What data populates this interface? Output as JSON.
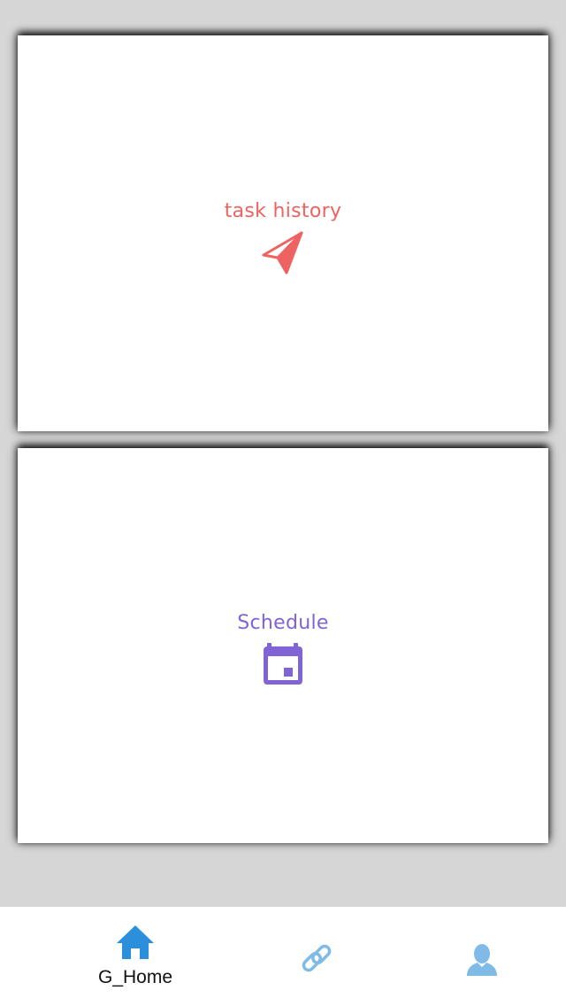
{
  "colors": {
    "background": "#d6d6d6",
    "card": "#ffffff",
    "task_history_accent": "#ee6361",
    "schedule_accent": "#8064d6",
    "tab_active": "#2b8fdb",
    "tab_inactive": "#7fbbe6"
  },
  "cards": [
    {
      "label": "task history",
      "icon": "paper-plane-icon"
    },
    {
      "label": "Schedule",
      "icon": "calendar-icon"
    }
  ],
  "tabbar": {
    "tabs": [
      {
        "label": "G_Home",
        "icon": "home-icon",
        "active": true
      },
      {
        "label": "",
        "icon": "link-icon",
        "active": false
      },
      {
        "label": "",
        "icon": "person-icon",
        "active": false
      }
    ]
  }
}
